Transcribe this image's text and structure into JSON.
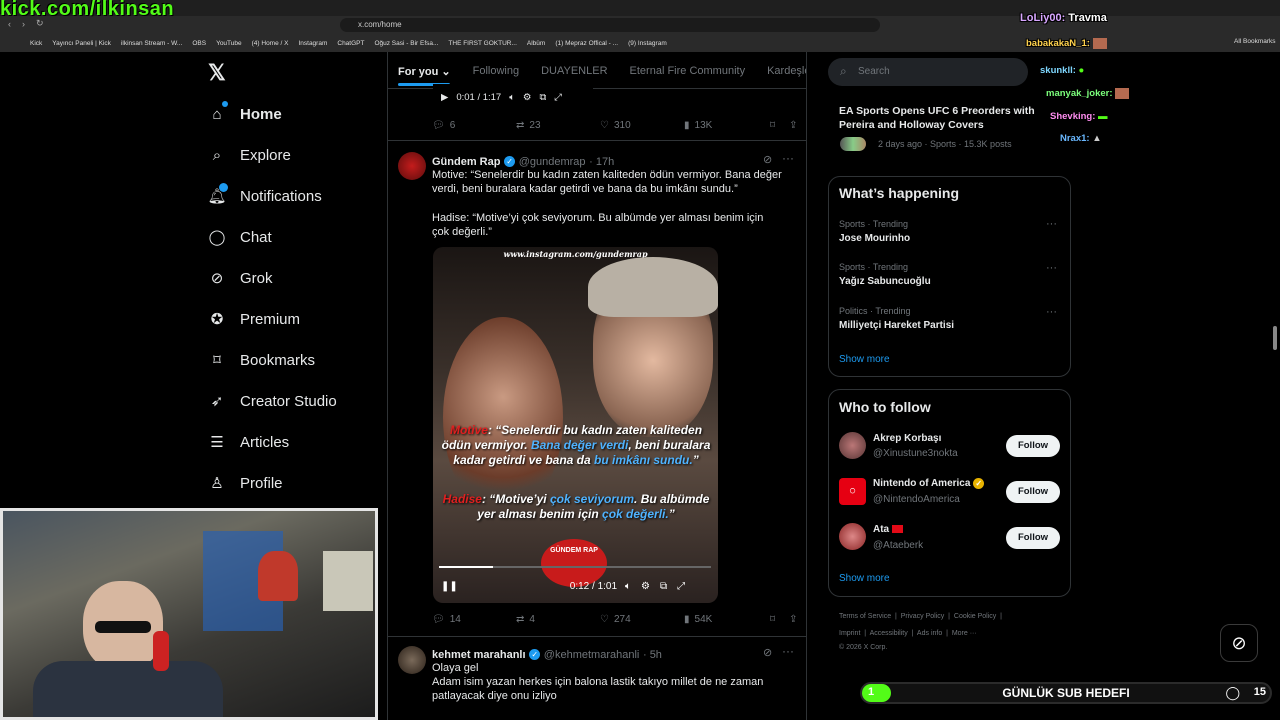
{
  "overlay": {
    "channel": "kick.com/ilkinsan"
  },
  "browser": {
    "url": "x.com/home",
    "bookmarks": [
      "Kick",
      "Yayıncı Paneli | Kick",
      "ilkinsan Stream - W...",
      "OBS",
      "YouTube",
      "(4) Home / X",
      "Instagram",
      "ChatGPT",
      "Oğuz Sasi - Bir Efsa...",
      "THE FIRST GOKTUR...",
      "Albüm",
      "(1) Mepraz Offical - ...",
      "(9) Instagram"
    ],
    "all_bookmarks": "All Bookmarks"
  },
  "nav": {
    "items": [
      {
        "label": "Home"
      },
      {
        "label": "Explore"
      },
      {
        "label": "Notifications"
      },
      {
        "label": "Chat"
      },
      {
        "label": "Grok"
      },
      {
        "label": "Premium"
      },
      {
        "label": "Bookmarks"
      },
      {
        "label": "Creator Studio"
      },
      {
        "label": "Articles"
      },
      {
        "label": "Profile"
      }
    ]
  },
  "feed": {
    "tabs": [
      "For you",
      "Following",
      "DUAYENLER",
      "Eternal Fire Community",
      "Kardeşle"
    ],
    "top_video": {
      "time": "0:01 / 1:17",
      "replies": "6",
      "reposts": "23",
      "likes": "310",
      "views": "13K"
    },
    "tweet1": {
      "name": "Gündem Rap",
      "handle": "@gundemrap",
      "time": "· 17h",
      "text1": "Motive: “Senelerdir bu kadın zaten kaliteden ödün vermiyor. Bana değer verdi, beni buralara kadar getirdi ve bana da bu imkânı sundu.”",
      "text2": "Hadise: “Motive’yi çok seviyorum. Bu albümde yer alması benim için çok değerli.”",
      "video_watermark": "www.instagram.com/gundemrap",
      "caption_name1": "Motive",
      "caption_body1a": ": “Senelerdir bu kadın zaten kaliteden ödün vermiyor. ",
      "caption_hl1": "Bana değer verdi",
      "caption_body1b": ", beni buralara kadar getirdi ve bana da ",
      "caption_hl2": "bu imkânı sundu.",
      "caption_end1": "”",
      "caption_name2": "Hadise",
      "caption_body2a": ": “Motive’yi ",
      "caption_hl3": "çok seviyorum",
      "caption_body2b": ". Bu albümde yer alması benim için ",
      "caption_hl4": "çok değerli.",
      "caption_end2": "”",
      "video_badge": "GÜNDEM RAP",
      "video_time": "0:12 / 1:01",
      "replies": "14",
      "reposts": "4",
      "likes": "274",
      "views": "54K"
    },
    "tweet2": {
      "name": "kehmet marahanlı",
      "handle": "@kehmetmarahanli",
      "time": "· 5h",
      "text1": "Olaya gel",
      "text2": "Adam isim yazan herkes için balona lastik takıyo millet de ne zaman patlayacak diye onu izliyo"
    }
  },
  "right": {
    "search_placeholder": "Search",
    "news": {
      "title": "EA Sports Opens UFC 6 Preorders with Pereira and Holloway Covers",
      "meta": "2 days ago · Sports · 15.3K posts"
    },
    "happening": {
      "title": "What’s happening",
      "trends": [
        {
          "meta": "Sports · Trending",
          "name": "Jose Mourinho"
        },
        {
          "meta": "Sports · Trending",
          "name": "Yağız Sabuncuoğlu"
        },
        {
          "meta": "Politics · Trending",
          "name": "Milliyetçi Hareket Partisi"
        }
      ],
      "show_more": "Show more"
    },
    "who_to_follow": {
      "title": "Who to follow",
      "accounts": [
        {
          "name": "Akrep Korbaşı",
          "handle": "@Xinustune3nokta",
          "button": "Follow"
        },
        {
          "name": "Nintendo of America",
          "handle": "@NintendoAmerica",
          "button": "Follow"
        },
        {
          "name": "Ata",
          "handle": "@Ataeberk",
          "button": "Follow"
        }
      ],
      "show_more": "Show more"
    },
    "footer": {
      "line1": "Terms of Service  |  Privacy Policy  |  Cookie Policy  |",
      "line2": "Imprint  |  Accessibility  |  Ads info  |  More ···",
      "copyright": "© 2026 X Corp."
    }
  },
  "chat": [
    {
      "user": "LoLiy00:",
      "msg": "Travma",
      "color": "#d7a6ff"
    },
    {
      "user": "babakakaN_1:",
      "msg": "",
      "color": "#ffd24d"
    },
    {
      "user": "skunkll:",
      "msg": "",
      "color": "#7fd7ff"
    },
    {
      "user": "manyak_joker:",
      "msg": "",
      "color": "#7cff7c"
    },
    {
      "user": "Shevking:",
      "msg": "",
      "color": "#ff8df0"
    },
    {
      "user": "Nrax1:",
      "msg": "",
      "color": "#6ab8ff"
    }
  ],
  "sub_goal": {
    "label": "GÜNLÜK SUB HEDEFI",
    "current": "1",
    "target": "15",
    "progress": 0.07
  }
}
